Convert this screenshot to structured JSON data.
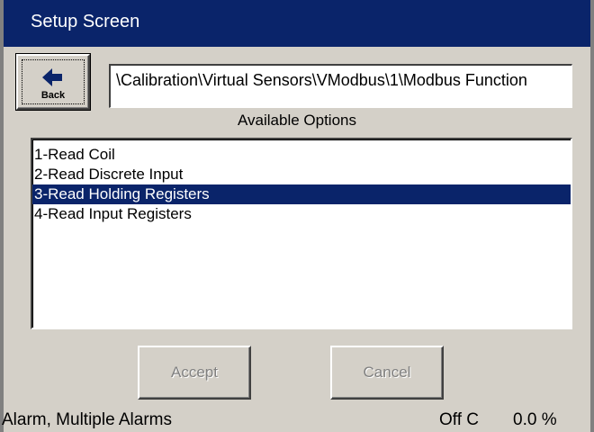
{
  "window": {
    "title": "Setup Screen"
  },
  "back_button": {
    "label": "Back",
    "icon": "arrow-left-icon"
  },
  "path": {
    "value": "\\Calibration\\Virtual Sensors\\VModbus\\1\\Modbus Function"
  },
  "options": {
    "heading": "Available Options",
    "items": [
      {
        "label": "1-Read Coil",
        "selected": false
      },
      {
        "label": "2-Read Discrete Input",
        "selected": false
      },
      {
        "label": "3-Read Holding Registers",
        "selected": true
      },
      {
        "label": "4-Read Input Registers",
        "selected": false
      }
    ]
  },
  "actions": {
    "accept_label": "Accept",
    "cancel_label": "Cancel",
    "enabled": false
  },
  "status": {
    "alarm": "Alarm, Multiple Alarms",
    "reading": "Off C",
    "percent": "0.0 %"
  },
  "colors": {
    "titlebar": "#0a246a",
    "selection": "#0a246a",
    "face": "#d4d0c8",
    "disabled_text": "#808080"
  }
}
